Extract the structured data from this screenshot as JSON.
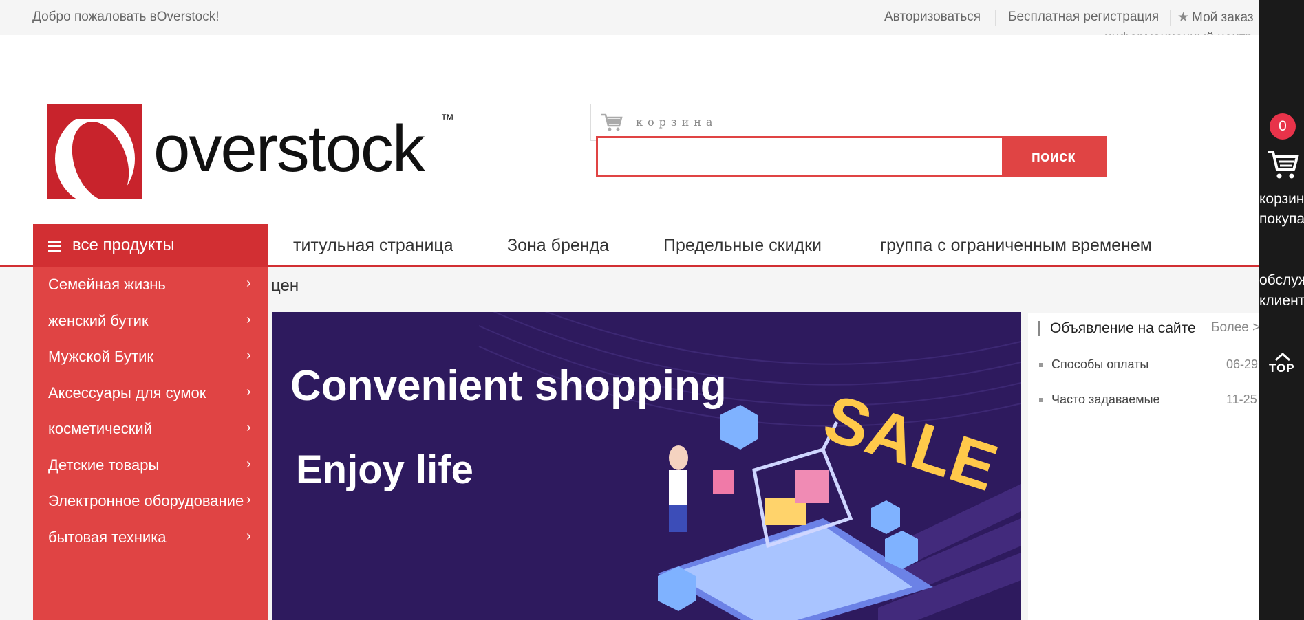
{
  "topbar": {
    "welcome": "Добро пожаловать вOverstock!",
    "login": "Авторизоваться",
    "register": "Бесплатная регистрация",
    "orders": "Мой заказ",
    "info_center": "информационный центр"
  },
  "logo": {
    "text": "overstock",
    "tm": "™",
    "brand_color": "#c8232c"
  },
  "cart_box": {
    "label": "корзина",
    "icon": "cart-icon"
  },
  "search": {
    "value": "",
    "placeholder": "",
    "button": "поиск"
  },
  "nav": {
    "all_products": "все продукты",
    "items": [
      "титульная страница",
      "Зона бренда",
      "Предельные скидки",
      "группа с ограниченным временем"
    ]
  },
  "side_menu": [
    {
      "label": "Семейная жизнь",
      "arrow": "›"
    },
    {
      "label": "женский бутик",
      "arrow": "›"
    },
    {
      "label": "Мужской Бутик",
      "arrow": "›"
    },
    {
      "label": "Аксессуары для сумок",
      "arrow": "›"
    },
    {
      "label": "косметический",
      "arrow": "›"
    },
    {
      "label": "Детские товары",
      "arrow": "›"
    },
    {
      "label": "Электронное оборудование",
      "arrow": "›"
    },
    {
      "label": "бытовая техника",
      "arrow": "›"
    }
  ],
  "crumb": "цен",
  "banner": {
    "line1": "Convenient shopping",
    "line2": "Enjoy life",
    "sale_text": "SALE",
    "bg_color": "#2e1a5e"
  },
  "notice": {
    "title": "Объявление на сайте",
    "more": "Более >",
    "items": [
      {
        "text": "Способы оплаты",
        "date": "06-29"
      },
      {
        "text": "Часто задаваемые",
        "date": "11-25"
      }
    ]
  },
  "right_bar": {
    "cart_count": "0",
    "cart_line1": "корзина",
    "cart_line2": "покупа",
    "service_line1": "обслуж",
    "service_line2": "клиент",
    "top": "TOP"
  },
  "colors": {
    "accent": "#e04444",
    "nav_red": "#d22f33",
    "badge": "#e8334a",
    "sidebar_dark": "#1a1a1a"
  }
}
